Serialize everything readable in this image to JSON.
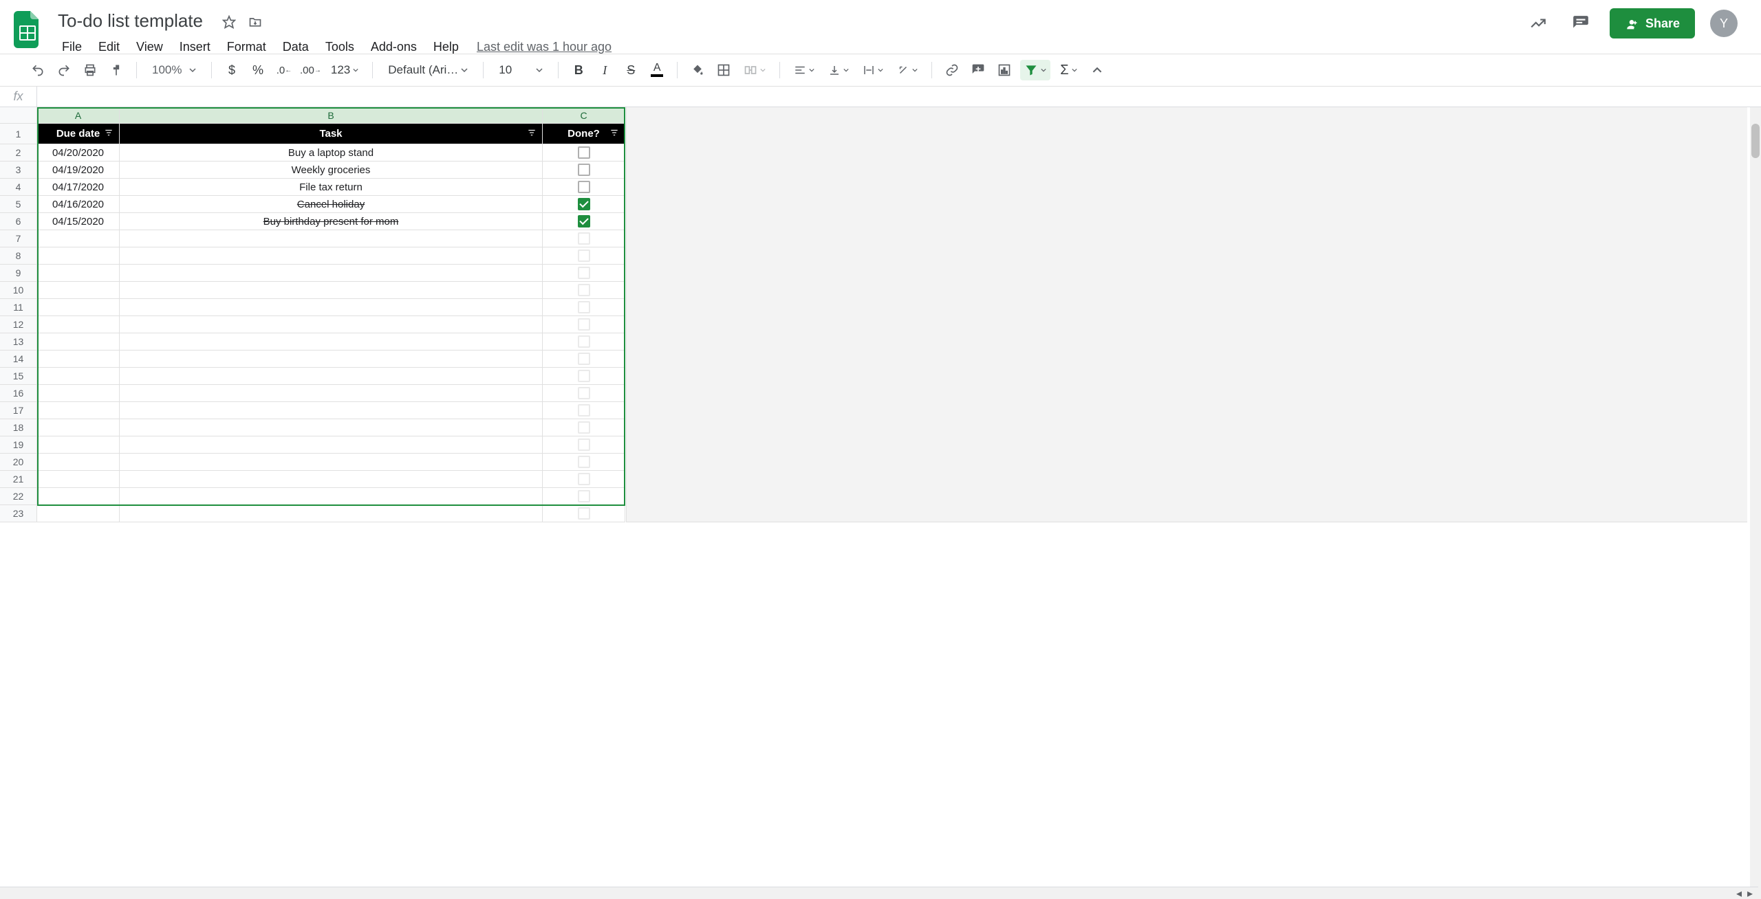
{
  "doc": {
    "title": "To-do list template",
    "last_edit": "Last edit was 1 hour ago",
    "avatar_initial": "Y",
    "share_label": "Share"
  },
  "menubar": [
    "File",
    "Edit",
    "View",
    "Insert",
    "Format",
    "Data",
    "Tools",
    "Add-ons",
    "Help"
  ],
  "toolbar": {
    "zoom": "100%",
    "font": "Default (Ari…",
    "font_size": "10",
    "number_format": "123"
  },
  "columns": [
    "A",
    "B",
    "C"
  ],
  "headers": {
    "A": "Due date",
    "B": "Task",
    "C": "Done?"
  },
  "rows": [
    {
      "date": "04/20/2020",
      "task": "Buy a laptop stand",
      "done": false
    },
    {
      "date": "04/19/2020",
      "task": "Weekly groceries",
      "done": false
    },
    {
      "date": "04/17/2020",
      "task": "File tax return",
      "done": false
    },
    {
      "date": "04/16/2020",
      "task": "Cancel holiday",
      "done": true
    },
    {
      "date": "04/15/2020",
      "task": "Buy birthday present for mom",
      "done": true
    }
  ],
  "total_rows_visible": 23
}
